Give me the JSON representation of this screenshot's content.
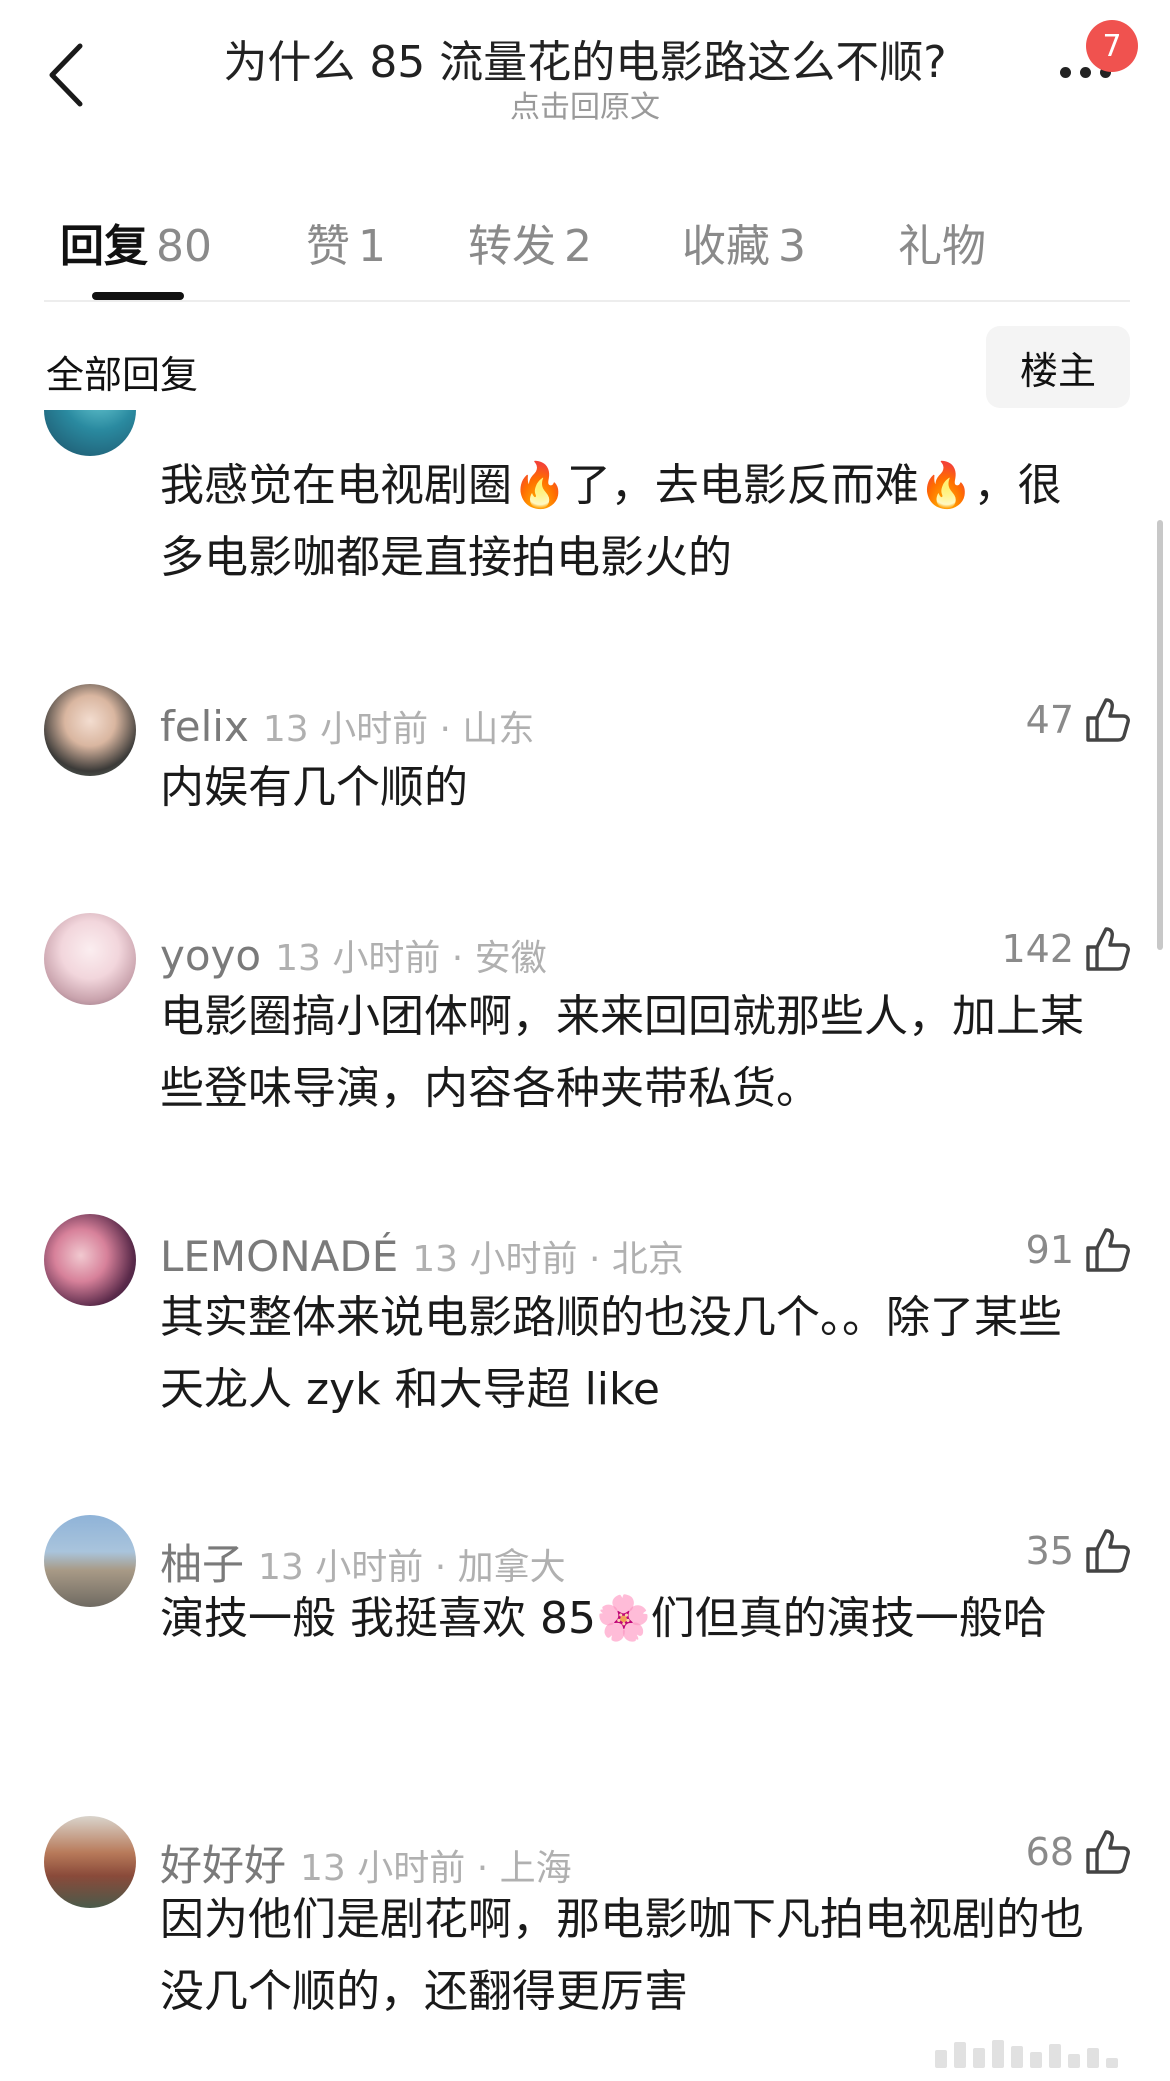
{
  "header": {
    "title": "为什么 85 流量花的电影路这么不顺?",
    "subtitle": "点击回原文",
    "notification_count": "7",
    "back_icon": "chevron-left-icon",
    "more_icon": "more-dots-icon"
  },
  "tabs": [
    {
      "label": "回复",
      "count": "80",
      "active": true
    },
    {
      "label": "赞",
      "count": "1",
      "active": false
    },
    {
      "label": "转发",
      "count": "2",
      "active": false
    },
    {
      "label": "收藏",
      "count": "3",
      "active": false
    },
    {
      "label": "礼物",
      "count": "",
      "active": false
    }
  ],
  "filter": {
    "label": "全部回复",
    "owner_button": "楼主"
  },
  "partial_comment": {
    "text": "我感觉在电视剧圈🔥了，去电影反而难🔥，很多电影咖都是直接拍电影火的"
  },
  "comments": [
    {
      "user": "felix",
      "meta": "13 小时前 · 山东",
      "likes": "47",
      "text": "内娱有几个顺的"
    },
    {
      "user": "yoyo",
      "meta": "13 小时前 · 安徽",
      "likes": "142",
      "text": "电影圈搞小团体啊，来来回回就那些人，加上某些登味导演，内容各种夹带私货。"
    },
    {
      "user": "LEMONADÉ",
      "meta": "13 小时前 · 北京",
      "likes": "91",
      "text": "其实整体来说电影路顺的也没几个。。除了某些天龙人 zyk 和大导超 like"
    },
    {
      "user": "柚子",
      "meta": "13 小时前 · 加拿大",
      "likes": "35",
      "text": "演技一般 我挺喜欢 85🌸们但真的演技一般哈"
    },
    {
      "user": "好好好",
      "meta": "13 小时前 · 上海",
      "likes": "68",
      "text": "因为他们是剧花啊，那电影咖下凡拍电视剧的也没几个顺的，还翻得更厉害"
    }
  ],
  "colors": {
    "badge": "#f0524f",
    "text_primary": "#1a1a1a",
    "text_secondary": "#8a8a8a",
    "text_tertiary": "#b0b0b0"
  }
}
